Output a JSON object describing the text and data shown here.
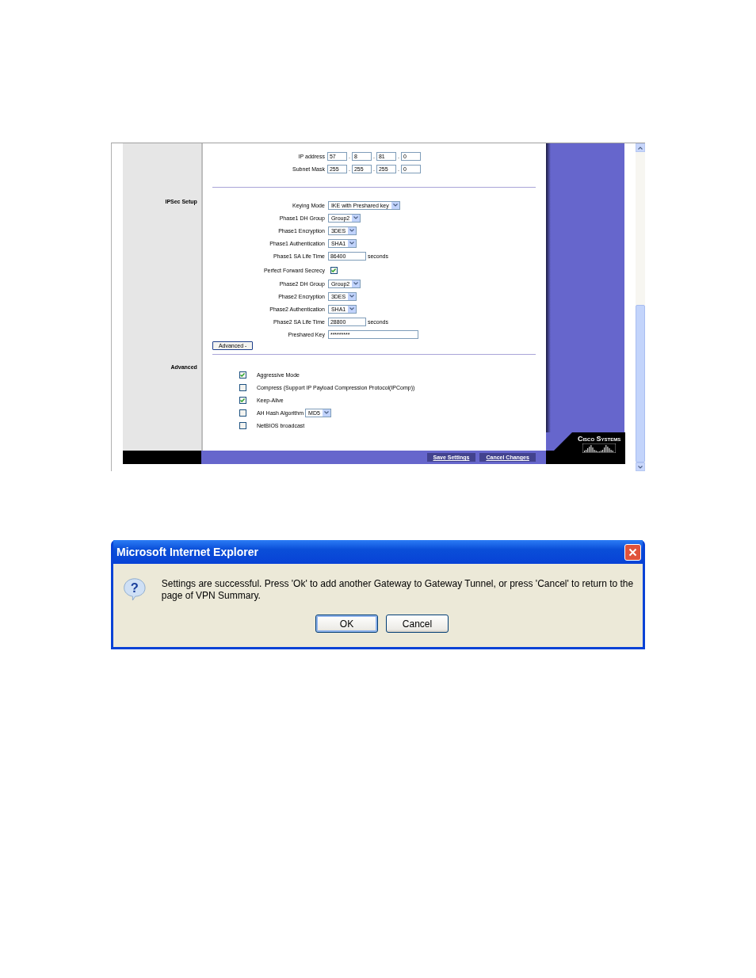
{
  "address_rows": [
    {
      "label": "IP address",
      "separator": ".",
      "octets": [
        "57",
        "8",
        "81",
        "0"
      ]
    },
    {
      "label": "Subnet Mask",
      "separator": ".",
      "octets": [
        "255",
        "255",
        "255",
        "0"
      ]
    }
  ],
  "ipsec": {
    "heading": "IPSec Setup",
    "rows": [
      {
        "kind": "select",
        "label": "Keying Mode",
        "value": "IKE with Preshared key"
      },
      {
        "kind": "select",
        "label": "Phase1 DH Group",
        "value": "Group2"
      },
      {
        "kind": "select",
        "label": "Phase1 Encryption",
        "value": "3DES"
      },
      {
        "kind": "select",
        "label": "Phase1 Authentication",
        "value": "SHA1"
      },
      {
        "kind": "input",
        "label": "Phase1 SA Life Time",
        "value": "86400",
        "unit": "seconds"
      },
      {
        "kind": "checkbox",
        "label": "Perfect Forward Secrecy",
        "checked": true
      },
      {
        "kind": "select",
        "label": "Phase2 DH Group",
        "value": "Group2"
      },
      {
        "kind": "select",
        "label": "Phase2 Encryption",
        "value": "3DES"
      },
      {
        "kind": "select",
        "label": "Phase2 Authentication",
        "value": "SHA1"
      },
      {
        "kind": "input",
        "label": "Phase2 SA Life Time",
        "value": "28800",
        "unit": "seconds"
      },
      {
        "kind": "password",
        "label": "Preshared Key",
        "value": "*********"
      }
    ],
    "advanced_button": "Advanced -"
  },
  "advanced": {
    "heading": "Advanced",
    "options": [
      {
        "label": "Aggressive Mode",
        "checked": true
      },
      {
        "label": "Compress (Support IP Payload Compression Protocol(IPComp))",
        "checked": false
      },
      {
        "label": "Keep-Alive",
        "checked": true
      },
      {
        "label": "AH Hash Algorithm",
        "checked": false,
        "select": "MD5"
      },
      {
        "label": "NetBIOS broadcast",
        "checked": false
      }
    ]
  },
  "footer_buttons": [
    "Save Settings",
    "Cancel Changes"
  ],
  "logo": "Cisco Systems",
  "dialog": {
    "title": "Microsoft Internet Explorer",
    "icon_glyph": "?",
    "message": "Settings are successful. Press 'Ok' to add another Gateway to Gateway Tunnel, or press 'Cancel' to return to the page of VPN Summary.",
    "buttons": [
      {
        "label": "OK",
        "selected": true
      },
      {
        "label": "Cancel",
        "selected": false
      }
    ]
  }
}
